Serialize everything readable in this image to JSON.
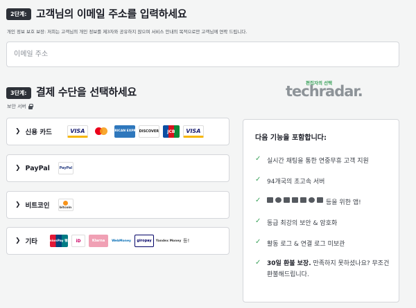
{
  "step2": {
    "badge": "2단계:",
    "heading": "고객님의 이메일 주소를 입력하세요",
    "privacy_note": "개인 정보 보호 보장: 저희는 고객님의 개인 정보를 제3자와 공유하지 않으며 서비스 안내의 목적으로만 고객님께 연락 드립니다.",
    "email_placeholder": "이메일 주소"
  },
  "step3": {
    "badge": "3단계:",
    "heading": "결제 수단을 선택하세요",
    "secure_label": "보안 서버"
  },
  "payment_options": [
    {
      "label": "신용 카드",
      "logos": [
        "VISA",
        "Mastercard",
        "AMERICAN EXPRESS",
        "DISCOVER",
        "JCB",
        "VISA"
      ]
    },
    {
      "label": "PayPal",
      "logos": [
        "PayPal"
      ]
    },
    {
      "label": "비트코인",
      "logos": [
        "bitcoin"
      ]
    },
    {
      "label": "기타",
      "logos": [
        "UnionPay 银联",
        "iD",
        "Klarna",
        "WebMoney",
        "giropay",
        "Yandex Money"
      ],
      "more": "등!"
    }
  ],
  "techradar": {
    "pick": "편집자의 선택",
    "logo": "techradar."
  },
  "features": {
    "title": "다음 기능을 포함합니다:",
    "items": [
      "실시간 채팅을 통한 연중무휴 고객 지원",
      "94개국의 초고속 서버",
      "등을 위한 앱!",
      "동급 최강의 보안 & 암호화",
      "활동 로그 & 연결 로그 미보관"
    ],
    "guarantee_bold": "30일 환불 보장.",
    "guarantee_rest": " 만족하지 못하셨나요? 무조건 환불해드립니다."
  },
  "colors": {
    "accent_green": "#3da35d",
    "badge_bg": "#2d3138",
    "page_bg": "#f4f5f5"
  },
  "icons": {
    "check": "check-icon",
    "lock": "lock-icon",
    "chevron": "chevron-right-icon"
  }
}
